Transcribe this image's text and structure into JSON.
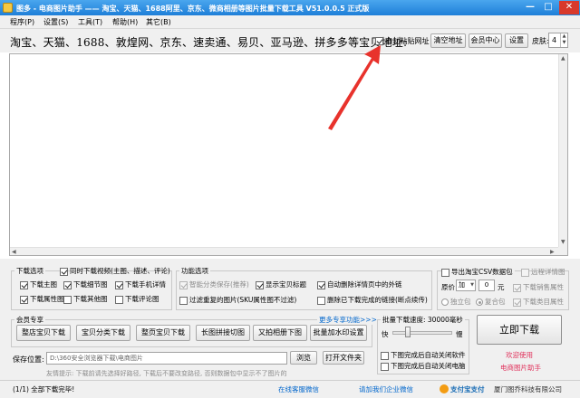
{
  "titlebar": {
    "title": "图多 - 电商图片助手 —— 淘宝、天猫、1688阿里、京东、微商相册等图片批量下载工具 V51.0.0.5 正式版",
    "minimize": "—",
    "maximize": "□",
    "close": "✕"
  },
  "menu": {
    "items": [
      "程序(P)",
      "设置(S)",
      "工具(T)",
      "帮助(H)",
      "其它(B)"
    ]
  },
  "toolbar": {
    "sites_label": "淘宝、天猫、1688、敦煌网、京东、速卖通、易贝、亚马逊、拼多多等宝贝地址:",
    "auto_paste_label": "自动粘贴网址",
    "auto_paste_checked": true,
    "clear_button": "清空地址",
    "member_button": "会员中心",
    "settings_button": "设置",
    "skin_label": "皮肤:",
    "skin_value": "4"
  },
  "url_input": {
    "value": ""
  },
  "download_options": {
    "title": "下载选项",
    "items": [
      {
        "label": "同时下载视频(主图、描述、评论)",
        "checked": true
      },
      {
        "label": "下载主图",
        "checked": true
      },
      {
        "label": "下载细节图",
        "checked": true
      },
      {
        "label": "下载手机详情",
        "checked": true
      },
      {
        "label": "下载属性图",
        "checked": true
      },
      {
        "label": "下载其他图",
        "checked": false
      },
      {
        "label": "下载评论图",
        "checked": false
      }
    ]
  },
  "function_options": {
    "title": "功能选项",
    "items": [
      {
        "label": "智能分类保存(推荐)",
        "checked": true,
        "disabled": true
      },
      {
        "label": "显示宝贝标题",
        "checked": true
      },
      {
        "label": "自动删除详情页中的外链",
        "checked": true
      },
      {
        "label": "过滤重复的图片(SKU属性图不过滤)",
        "checked": false
      },
      {
        "label": "删除已下载完成的链接(断点续传)",
        "checked": false
      }
    ]
  },
  "right_options": {
    "export_csv": "导出淘宝CSV数据包",
    "export_csv_checked": false,
    "image_list": "远程详情图",
    "image_list_checked": false,
    "original_label": "原价",
    "original_select": "加",
    "original_value": "0",
    "original_unit": "元",
    "sale_props": "下载销售属性",
    "sale_props_checked": true,
    "independent": "独立包",
    "combined": "复合包",
    "category_props": "下载类目属性",
    "category_props_checked": true
  },
  "member": {
    "title": "会员专享",
    "more": "更多专享功能>>>",
    "buttons": [
      "整店宝贝下载",
      "宝贝分类下载",
      "整页宝贝下载",
      "长图拼接切图",
      "又拍相册下图",
      "批量加水印设置"
    ]
  },
  "speed": {
    "title": "批量下载速度: 30000毫秒",
    "fast": "快",
    "slow": "慢",
    "level": 0.25,
    "shutdown": "下图完成后自动关闭软件",
    "shutdown_checked": false,
    "poweroff": "下图完成后自动关闭电脑",
    "poweroff_checked": false
  },
  "action": {
    "download_button": "立即下载",
    "welcome": "欢迎使用",
    "app_name": "电商图片助手"
  },
  "save": {
    "label": "保存位置:",
    "path": "D:\\360安全浏览器下载\\电商图片",
    "browse": "浏览",
    "open_folder": "打开文件夹",
    "tip": "友情提示: 下载前请先选择好路径, 下载后不要改变路径, 否则数据包中显示不了图片的"
  },
  "status": {
    "progress": "(1/1) 全部下载完毕!",
    "online_service": "在线客服微信",
    "enterprise": "请加我们企业微信",
    "pay": "支付宝支付",
    "company": "厦门图乔科技有限公司"
  },
  "colors": {
    "title_bar": "#1e7fd8",
    "link": "#0066cc",
    "accent_red": "#e8322c",
    "welcome_red": "#e0315b"
  }
}
